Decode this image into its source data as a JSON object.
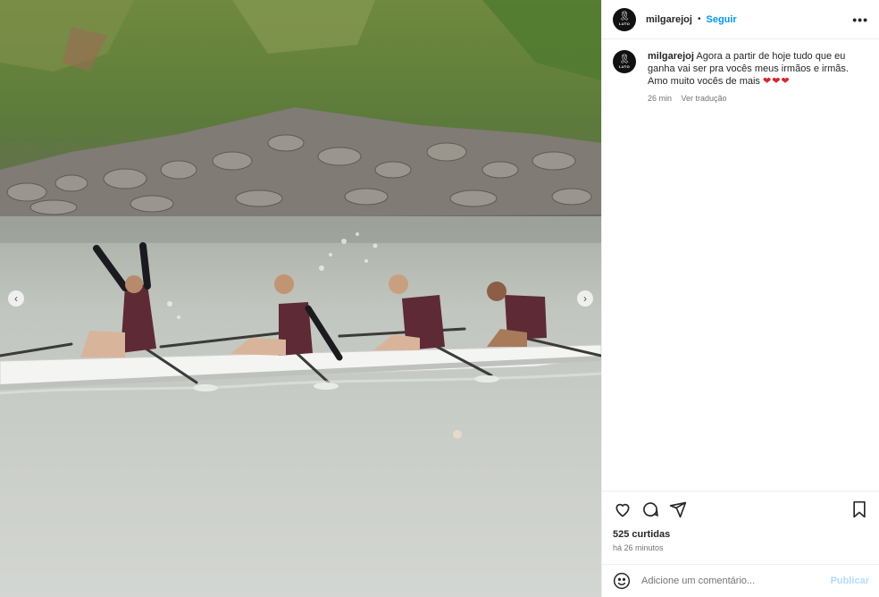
{
  "post": {
    "username": "milgarejoj",
    "separator": "•",
    "follow_label": "Seguir",
    "more_label": "•••",
    "avatar_mark": "LUTO",
    "caption_text": "Agora a partir de hoje tudo que eu ganha vai ser pra vocês meus irmãos e irmãs. Amo muito vocês de mais",
    "caption_hearts": "❤❤❤",
    "caption_age": "26 min",
    "translate_label": "Ver tradução",
    "likes": "525 curtidas",
    "posted_ago": "há 26 minutos"
  },
  "comment": {
    "placeholder": "Adicione um comentário...",
    "publish_label": "Publicar"
  },
  "carousel": {
    "prev_glyph": "‹",
    "next_glyph": "›"
  },
  "icons": {
    "like": "heart-icon",
    "comment": "comment-icon",
    "share": "share-icon",
    "save": "bookmark-icon",
    "emoji": "emoji-icon"
  },
  "colors": {
    "follow": "#0095f6",
    "hearts": "#d9252d",
    "publish_disabled": "#b3dbff"
  }
}
